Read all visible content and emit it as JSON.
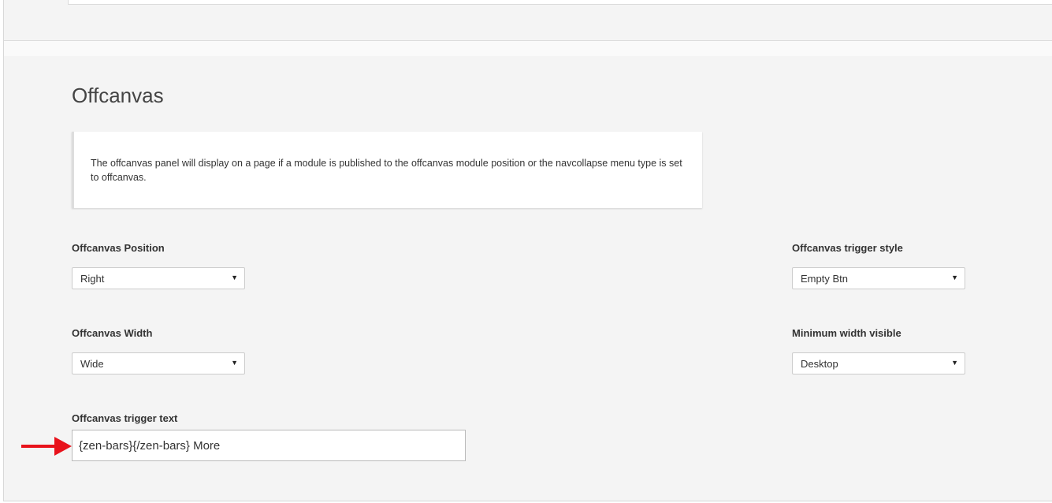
{
  "section": {
    "title": "Offcanvas",
    "info": "The offcanvas panel will display on a page if a module is published to the offcanvas module position or the navcollapse menu type is set to offcanvas."
  },
  "fields": {
    "position": {
      "label": "Offcanvas Position",
      "value": "Right"
    },
    "trigger_style": {
      "label": "Offcanvas trigger style",
      "value": "Empty Btn"
    },
    "width": {
      "label": "Offcanvas Width",
      "value": "Wide"
    },
    "min_width_visible": {
      "label": "Minimum width visible",
      "value": "Desktop"
    },
    "trigger_text": {
      "label": "Offcanvas trigger text",
      "value": "{zen-bars}{/zen-bars} More"
    }
  },
  "icons": {
    "dropdown_caret": "chevron-down-icon",
    "annotation_arrow": "arrow-right-icon"
  },
  "colors": {
    "annotation_arrow": "#e8121b",
    "panel_background": "#f4f4f4"
  }
}
